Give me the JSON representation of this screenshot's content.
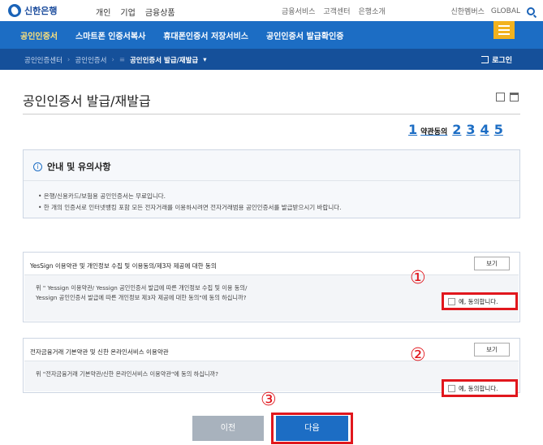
{
  "header": {
    "logo_text": "신한은행",
    "top_nav": [
      "개인",
      "기업",
      "금융상품"
    ],
    "top_links": [
      "금융서비스",
      "고객센터",
      "은행소개"
    ],
    "top_right": [
      "신한멤버스",
      "GLOBAL"
    ]
  },
  "main_nav": {
    "items": [
      "공인인증서",
      "스마트폰 인증서복사",
      "휴대폰인증서 저장서비스",
      "공인인증서 발급확인증"
    ],
    "active_index": 0
  },
  "breadcrumb": {
    "items": [
      "공인인증센터",
      "공인인증서",
      "공인인증서 발급/재발급"
    ],
    "login_label": "로그인"
  },
  "page": {
    "title": "공인인증서 발급/재발급"
  },
  "steps": {
    "items": [
      "1",
      "2",
      "3",
      "4",
      "5"
    ],
    "active_label": "약관동의"
  },
  "notice": {
    "icon_text": "i",
    "title": "안내 및 유의사항",
    "items": [
      "• 은행/신용카드/보험용 공인인증서는 무료입니다.",
      "• 한 개의 인증서로 인터넷뱅킹 포함 모든 전자거래를 이용하시려면 전자거래범용 공인인증서를 발급받으시기 바랍니다."
    ]
  },
  "agreements": [
    {
      "title": "YesSign 이용약관 및 개인정보 수집 및 이용동의/제3자 제공에 대한 동의",
      "view_label": "보기",
      "question_line1": "위 \" Yessign 이용약관/ Yessign 공인인증서 발급에 따른 개인정보 수집 및 이용 동의/",
      "question_line2": "Yessign 공인인증서 발급에 따른 개인정보 제3자 제공에 대한 동의\"에 동의 하십니까?",
      "consent_label": "예, 동의합니다.",
      "checked": false,
      "marker": "①"
    },
    {
      "title": "전자금융거래 기본약관 및 신한 온라인서비스 이용약관",
      "view_label": "보기",
      "question_line1": "위 \"전자금융거래 기본약관/신한 온라인서비스 이용약관\"에 동의 하십니까?",
      "question_line2": "",
      "consent_label": "예, 동의합니다.",
      "checked": false,
      "marker": "②"
    }
  ],
  "buttons": {
    "prev_label": "이전",
    "next_label": "다음",
    "next_marker": "③"
  },
  "colors": {
    "primary_blue": "#1c6dc4",
    "dark_blue": "#15509a",
    "highlight_red": "#e1171d",
    "menu_yellow": "#f2b21e"
  }
}
